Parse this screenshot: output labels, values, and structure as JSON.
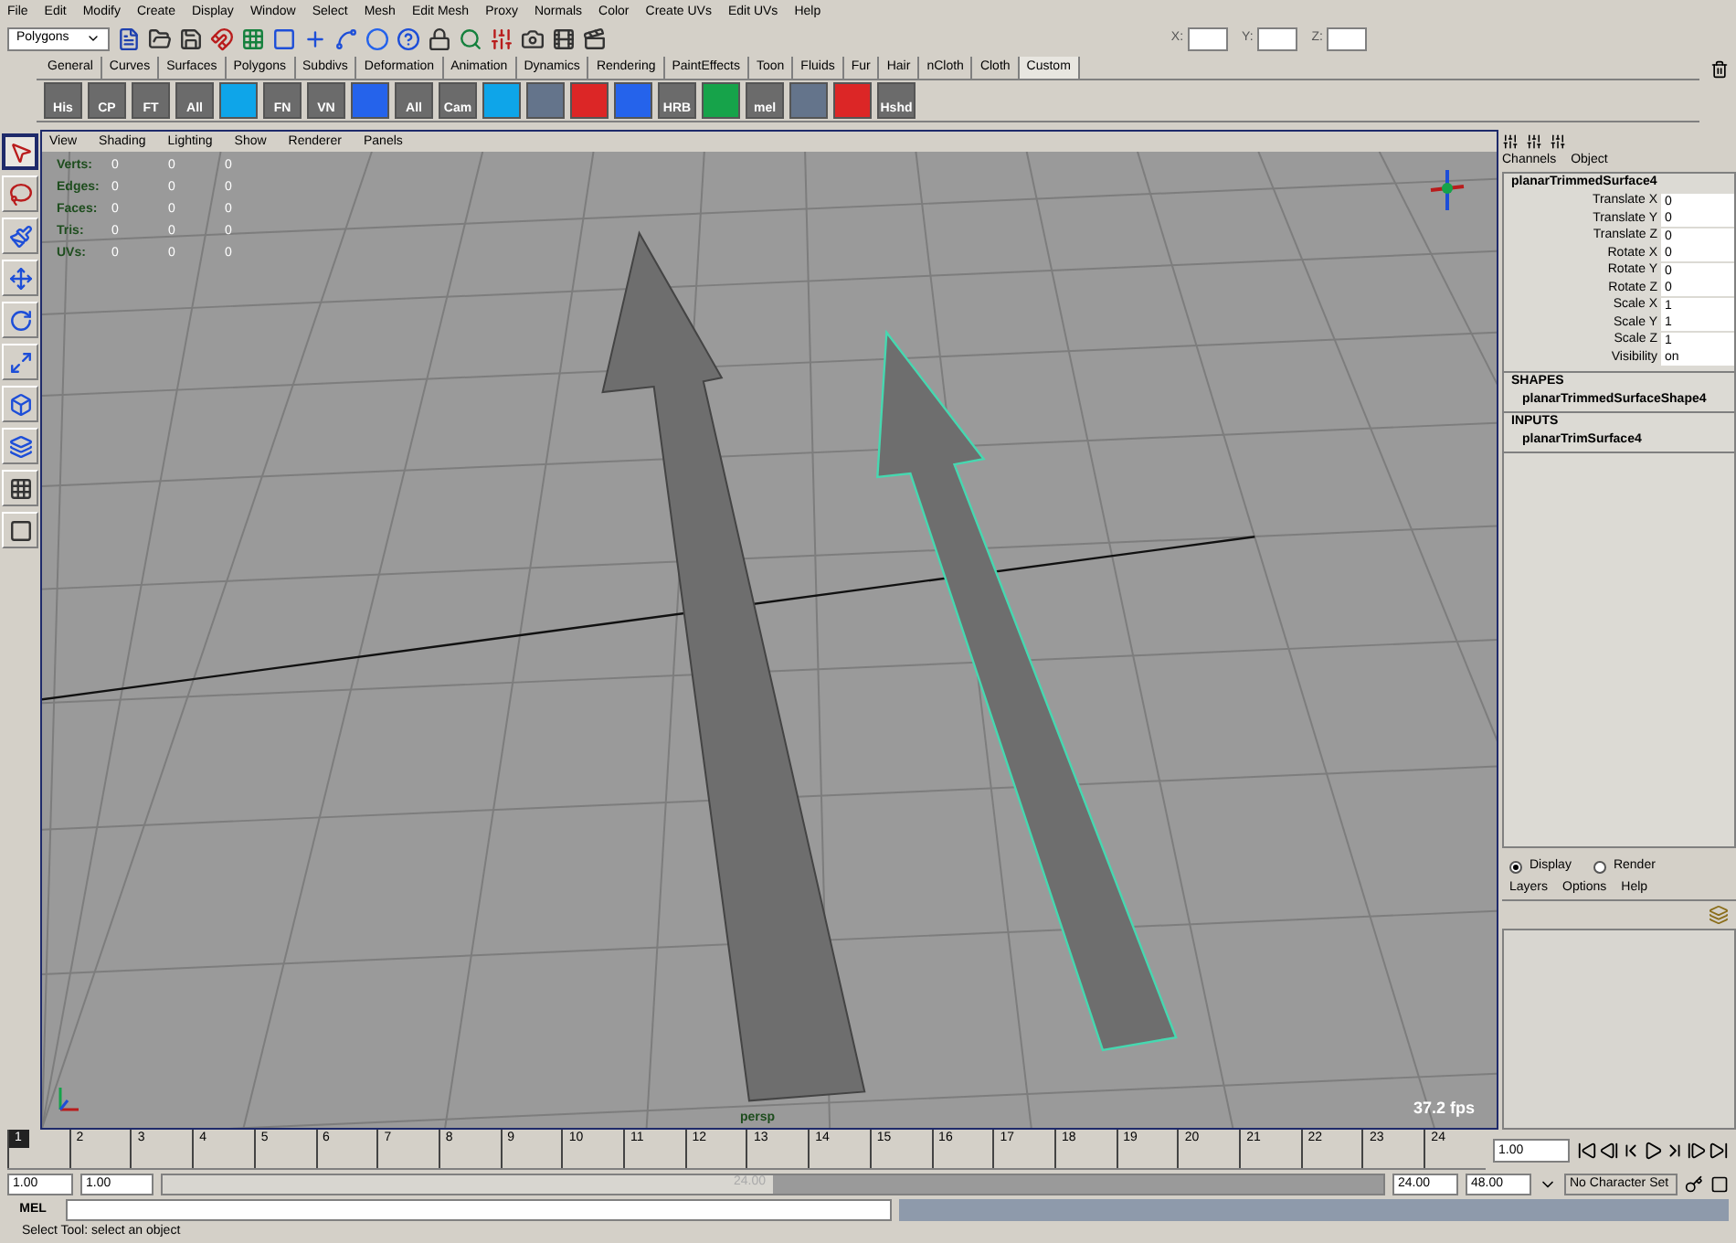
{
  "menubar": [
    "File",
    "Edit",
    "Modify",
    "Create",
    "Display",
    "Window",
    "Select",
    "Mesh",
    "Edit Mesh",
    "Proxy",
    "Normals",
    "Color",
    "Create UVs",
    "Edit UVs",
    "Help"
  ],
  "status_line": {
    "mode": "Polygons",
    "fields": [
      {
        "label": "X:"
      },
      {
        "label": "Y:"
      },
      {
        "label": "Z:"
      }
    ]
  },
  "shelf_tabs": [
    {
      "label": "General",
      "selected": false
    },
    {
      "label": "Curves",
      "selected": false
    },
    {
      "label": "Surfaces",
      "selected": false
    },
    {
      "label": "Polygons",
      "selected": false
    },
    {
      "label": "Subdivs",
      "selected": false
    },
    {
      "label": "Deformation",
      "selected": false
    },
    {
      "label": "Animation",
      "selected": false
    },
    {
      "label": "Dynamics",
      "selected": false
    },
    {
      "label": "Rendering",
      "selected": false
    },
    {
      "label": "PaintEffects",
      "selected": false
    },
    {
      "label": "Toon",
      "selected": false
    },
    {
      "label": "Fluids",
      "selected": false
    },
    {
      "label": "Fur",
      "selected": false
    },
    {
      "label": "Hair",
      "selected": false
    },
    {
      "label": "nCloth",
      "selected": false
    },
    {
      "label": "Cloth",
      "selected": false
    },
    {
      "label": "Custom",
      "selected": true
    }
  ],
  "shelf_items": [
    {
      "label": "His"
    },
    {
      "label": "CP"
    },
    {
      "label": "FT"
    },
    {
      "label": "All"
    },
    {
      "kind": "blank"
    },
    {
      "label": "FN"
    },
    {
      "label": "VN"
    },
    {
      "kind": "blank"
    },
    {
      "label": "All"
    },
    {
      "label": "Cam"
    },
    {
      "kind": "blank"
    },
    {
      "kind": "blank"
    },
    {
      "kind": "blank"
    },
    {
      "kind": "blank"
    },
    {
      "label": "HRB"
    },
    {
      "kind": "blank"
    },
    {
      "label": "mel"
    },
    {
      "kind": "blank"
    },
    {
      "kind": "blank"
    },
    {
      "label": "Hshd"
    }
  ],
  "toolbox": [
    {
      "selected": true
    },
    {
      "selected": false
    },
    {
      "selected": false
    },
    {
      "selected": false
    },
    {
      "selected": false
    },
    {
      "selected": false
    },
    {
      "selected": false
    },
    {
      "selected": false
    },
    {
      "selected": false
    },
    {
      "selected": false
    }
  ],
  "viewport": {
    "menus": [
      "View",
      "Shading",
      "Lighting",
      "Show",
      "Renderer",
      "Panels"
    ],
    "hud": [
      {
        "label": "Verts:",
        "values": [
          "0",
          "0",
          "0"
        ]
      },
      {
        "label": "Edges:",
        "values": [
          "0",
          "0",
          "0"
        ]
      },
      {
        "label": "Faces:",
        "values": [
          "0",
          "0",
          "0"
        ]
      },
      {
        "label": "Tris:",
        "values": [
          "0",
          "0",
          "0"
        ]
      },
      {
        "label": "UVs:",
        "values": [
          "0",
          "0",
          "0"
        ]
      }
    ],
    "camera": "persp",
    "fps": "37.2 fps"
  },
  "channel_box": {
    "tabs": [
      "Channels",
      "Object"
    ],
    "object": "planarTrimmedSurface4",
    "channels": [
      {
        "name": "Translate X",
        "value": "0"
      },
      {
        "name": "Translate Y",
        "value": "0"
      },
      {
        "name": "Translate Z",
        "value": "0"
      },
      {
        "name": "Rotate X",
        "value": "0"
      },
      {
        "name": "Rotate Y",
        "value": "0"
      },
      {
        "name": "Rotate Z",
        "value": "0"
      },
      {
        "name": "Scale X",
        "value": "1"
      },
      {
        "name": "Scale Y",
        "value": "1"
      },
      {
        "name": "Scale Z",
        "value": "1"
      },
      {
        "name": "Visibility",
        "value": "on"
      }
    ],
    "shapes_heading": "SHAPES",
    "shapes": [
      "planarTrimmedSurfaceShape4"
    ],
    "inputs_heading": "INPUTS",
    "inputs": [
      "planarTrimSurface4"
    ]
  },
  "layer_editor": {
    "modes": [
      {
        "label": "Display",
        "selected": true
      },
      {
        "label": "Render",
        "selected": false
      }
    ],
    "menus": [
      "Layers",
      "Options",
      "Help"
    ]
  },
  "timeline": {
    "frames": [
      {
        "label": "1",
        "selected": true
      },
      {
        "label": "2",
        "selected": false
      },
      {
        "label": "3",
        "selected": false
      },
      {
        "label": "4",
        "selected": false
      },
      {
        "label": "5",
        "selected": false
      },
      {
        "label": "6",
        "selected": false
      },
      {
        "label": "7",
        "selected": false
      },
      {
        "label": "8",
        "selected": false
      },
      {
        "label": "9",
        "selected": false
      },
      {
        "label": "10",
        "selected": false
      },
      {
        "label": "11",
        "selected": false
      },
      {
        "label": "12",
        "selected": false
      },
      {
        "label": "13",
        "selected": false
      },
      {
        "label": "14",
        "selected": false
      },
      {
        "label": "15",
        "selected": false
      },
      {
        "label": "16",
        "selected": false
      },
      {
        "label": "17",
        "selected": false
      },
      {
        "label": "18",
        "selected": false
      },
      {
        "label": "19",
        "selected": false
      },
      {
        "label": "20",
        "selected": false
      },
      {
        "label": "21",
        "selected": false
      },
      {
        "label": "22",
        "selected": false
      },
      {
        "label": "23",
        "selected": false
      },
      {
        "label": "24",
        "selected": false
      }
    ],
    "current_time": "1.00"
  },
  "range": {
    "start": "1.00",
    "playback_start": "1.00",
    "slider_label": "24.00",
    "level": 0.5,
    "playback_end": "24.00",
    "end": "48.00",
    "character_set": "No Character Set"
  },
  "command_line": {
    "label": "MEL"
  },
  "help_line": "Select Tool: select an object"
}
